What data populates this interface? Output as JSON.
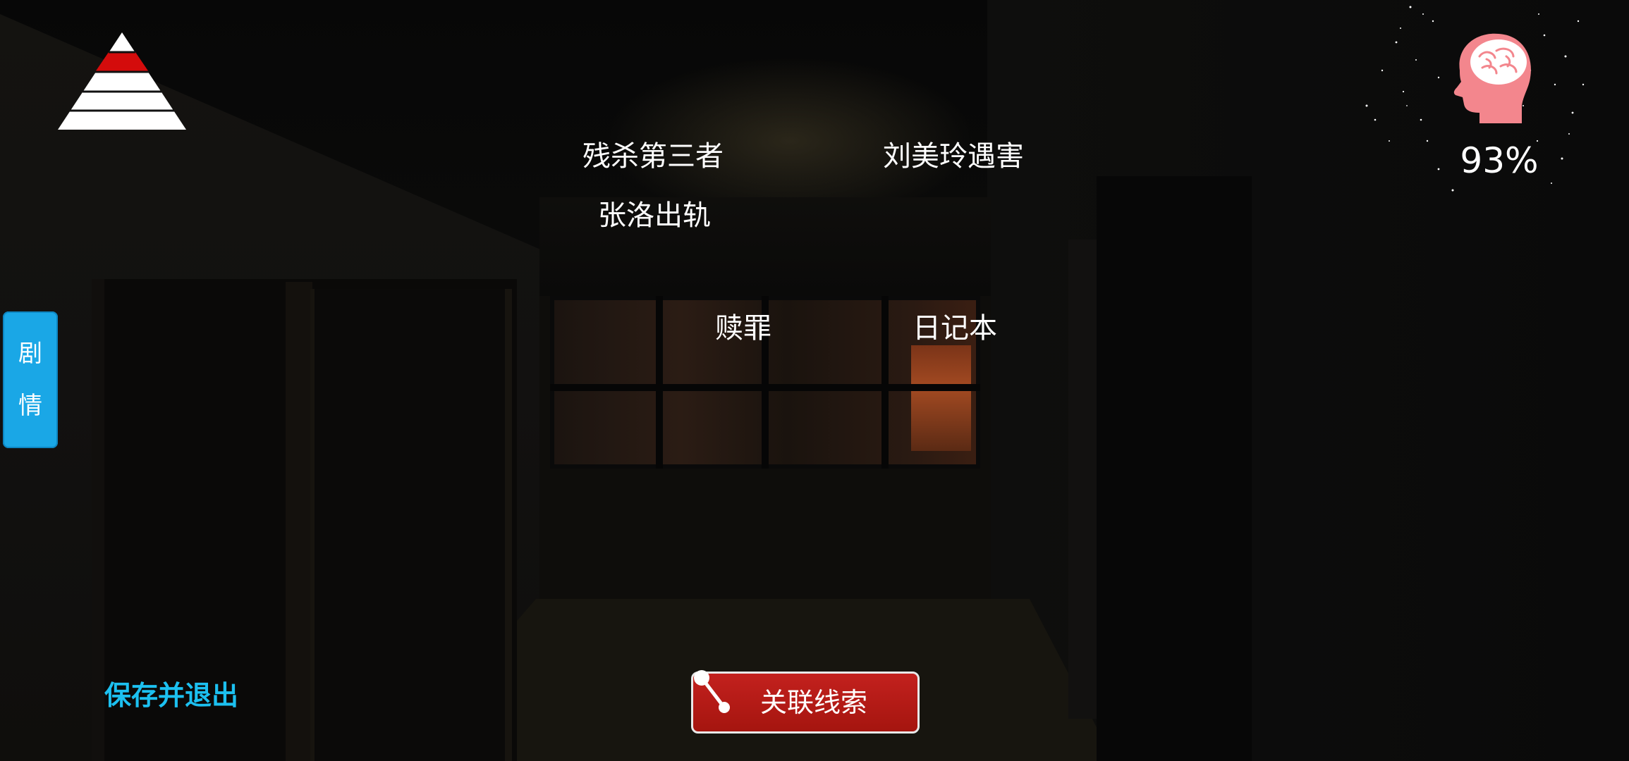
{
  "hud": {
    "pyramid_icon": "pyramid-progress-icon",
    "story_tab": {
      "char1": "剧",
      "char2": "情"
    },
    "sanity": {
      "icon": "brain-head-icon",
      "value_text": "93%",
      "value": 93
    },
    "save_exit_label": "保存并退出",
    "connect_button_label": "关联线索"
  },
  "clues": [
    "残杀第三者",
    "刘美玲遇害",
    "张洛出轨",
    "赎罪",
    "日记本"
  ],
  "colors": {
    "accent_blue": "#1aa7e6",
    "save_text": "#1cc0f0",
    "button_red": "#b51b16",
    "pyramid_highlight": "#d40c0c",
    "brain_pink": "#f3868d"
  }
}
